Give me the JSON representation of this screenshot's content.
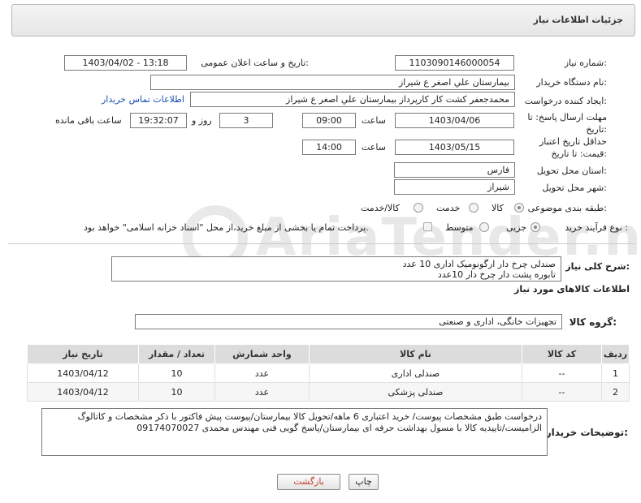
{
  "header": {
    "title": "جزئیات اطلاعات نیاز"
  },
  "form": {
    "need_number_label": "شماره نیاز:",
    "need_number": "1103090146000054",
    "announce_label": "تاریخ و ساعت اعلان عمومی:",
    "announce_value": "1403/04/02 - 13:18",
    "buyer_org_label": "نام دستگاه خریدار:",
    "buyer_org": "بیمارستان علي اصغر  ع  شیراز",
    "creator_label": "ایجاد کننده درخواست:",
    "creator": "محمدجعفر کشت کار کارپرداز بیمارستان علي اصغر  ع  شیراز",
    "contact_link": "اطلاعات تماس خریدار",
    "deadline_label": "مهلت ارسال پاسخ: تا تاریخ:",
    "deadline_date": "1403/04/06",
    "time_label": "ساعت",
    "deadline_time": "09:00",
    "days_value": "3",
    "days_label": "روز و",
    "remaining_time": "19:32:07",
    "remaining_label": "ساعت باقی مانده",
    "validity_label": "حداقل تاریخ اعتبار قیمت: تا تاریخ:",
    "validity_date": "1403/05/15",
    "validity_time": "14:00",
    "province_label": "استان محل تحویل:",
    "province": "فارس",
    "city_label": "شهر محل تحویل:",
    "city": "شیراز",
    "category_label": "طبقه بندی موضوعی:",
    "category_options": [
      "کالا",
      "خدمت",
      "کالا/خدمت"
    ],
    "purchase_type_label": "نوع فرآیند خرید :",
    "purchase_options": [
      "جزیی",
      "متوسط"
    ],
    "payment_note": "پرداخت تمام یا بخشی از مبلغ خرید،از محل \"اسناد خزانه اسلامی\" خواهد بود."
  },
  "summary": {
    "label": "شرح کلی نیاز:",
    "line1": "صندلی چرخ دار ارگونومیک اداری   10 عدد",
    "line2": "تابوره پشت دار چرخ دار      10عدد"
  },
  "goods": {
    "section_title": "اطلاعات کالاهای مورد نیاز",
    "group_label": "گروه کالا:",
    "group_value": "تجهیزات خانگی، اداری و صنعتی"
  },
  "table": {
    "headers": [
      "ردیف",
      "کد کالا",
      "نام کالا",
      "واحد شمارش",
      "تعداد / مقدار",
      "تاریخ نیاز"
    ],
    "rows": [
      {
        "row": "1",
        "code": "--",
        "name": "صندلی اداری",
        "unit": "عدد",
        "qty": "10",
        "date": "1403/04/12"
      },
      {
        "row": "2",
        "code": "--",
        "name": "صندلی پزشکی",
        "unit": "عدد",
        "qty": "10",
        "date": "1403/04/12"
      }
    ]
  },
  "notes": {
    "label": "توضیحات خریدار:",
    "text": "درخواست طبق مشخصات پیوست/ خرید اعتباری 6 ماهه/تحویل کالا بیمارستان/پیوست پیش فاکتور با ذکر مشخصات و کاتالوگ الزامیست/تاییدیه کالا با مسول بهداشت حرفه ای بیمارستان/پاسخ گویی فنی مهندس محمدی 09174070027"
  },
  "buttons": {
    "print": "چاپ",
    "back": "بازگشت"
  },
  "watermark": {
    "text": "AriaTender.net"
  }
}
